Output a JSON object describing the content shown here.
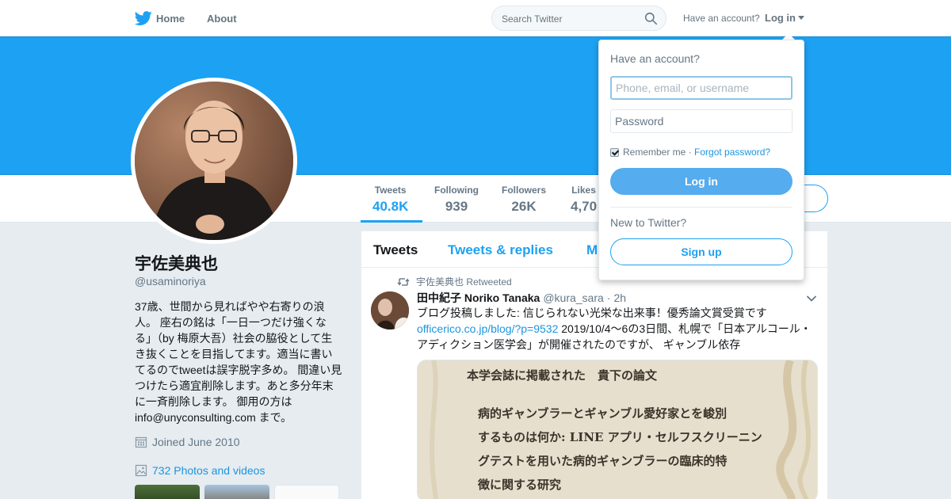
{
  "colors": {
    "accent": "#1da1f2",
    "banner": "#1da1f2",
    "link": "#1b95e0",
    "background": "#e6ecf0"
  },
  "nav": {
    "logo_icon": "twitter-bird-icon",
    "home_label": "Home",
    "about_label": "About",
    "search_placeholder": "Search Twitter",
    "search_icon": "search-icon",
    "have_account": "Have an account?",
    "login_label": "Log in"
  },
  "stats": [
    {
      "label": "Tweets",
      "value": "40.8K"
    },
    {
      "label": "Following",
      "value": "939"
    },
    {
      "label": "Followers",
      "value": "26K"
    },
    {
      "label": "Likes",
      "value": "4,70"
    }
  ],
  "profile": {
    "name": "宇佐美典也",
    "handle": "@usaminoriya",
    "bio": "37歳、世間から見ればやや右寄りの浪人。 座右の銘は「一日一つだけ強くなる」（by 梅原大吾）社会の脇役として生き抜くことを目指してます。適当に書いてるのでtweetは誤字脱字多め。 間違い見つけたら適宜削除します。あと多分年末に一斉削除します。 御用の方は info@unyconsulting.com まで。",
    "joined": "Joined June 2010",
    "photos": "732 Photos and videos"
  },
  "timeline": {
    "tabs": [
      "Tweets",
      "Tweets & replies",
      "M"
    ],
    "tweet": {
      "retweeted_by": "宇佐美典也 Retweeted",
      "author": "田中紀子 Noriko Tanaka",
      "handle": "@kura_sara",
      "dot": "·",
      "time": "2h",
      "text_before": "ブログ投稿しました: 信じられない光栄な出来事！優秀論文賞受賞です ",
      "link": "officerico.co.jp/blog/?p=9532",
      "text_after": " 2019/10/4～6の3日間、札幌で「日本アルコール・アディクション医学会」が開催されたのですが、 ギャンブル依存",
      "media_lines": [
        "本学会誌に掲載された　貴下の論文",
        "病的ギャンブラーとギャンブル愛好家とを峻別",
        "するものは何か: LINE アプリ・セルフスクリーニン",
        "グテストを用いた病的ギャンブラーの臨床的特",
        "徴に関する研究"
      ]
    }
  },
  "login_dropdown": {
    "title": "Have an account?",
    "username_placeholder": "Phone, email, or username",
    "password_placeholder": "Password",
    "remember": "Remember me",
    "separator": " · ",
    "forgot": "Forgot password?",
    "login_button": "Log in",
    "new_to": "New to Twitter?",
    "signup_button": "Sign up"
  }
}
